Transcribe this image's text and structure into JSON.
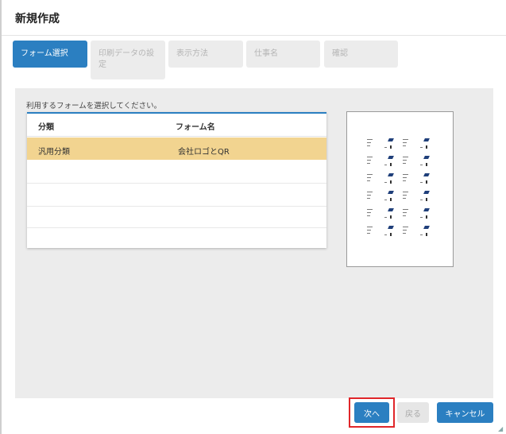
{
  "dialog": {
    "title": "新規作成"
  },
  "steps": [
    {
      "label": "フォーム選択",
      "active": true
    },
    {
      "label": "印刷データの設定",
      "active": false
    },
    {
      "label": "表示方法",
      "active": false
    },
    {
      "label": "仕事名",
      "active": false
    },
    {
      "label": "確認",
      "active": false
    }
  ],
  "form_select": {
    "prompt": "利用するフォームを選択してください。",
    "columns": [
      "分類",
      "フォーム名"
    ],
    "rows": [
      {
        "category": "汎用分類",
        "form_name": "会社ロゴとQR",
        "selected": true
      }
    ]
  },
  "buttons": {
    "next": "次へ",
    "back": "戻る",
    "cancel": "キャンセル"
  },
  "colors": {
    "accent": "#2b7fc1",
    "selected_row": "#f2d490",
    "highlight": "#e0262a"
  },
  "icons": {
    "resize": "resize-grip-icon"
  }
}
